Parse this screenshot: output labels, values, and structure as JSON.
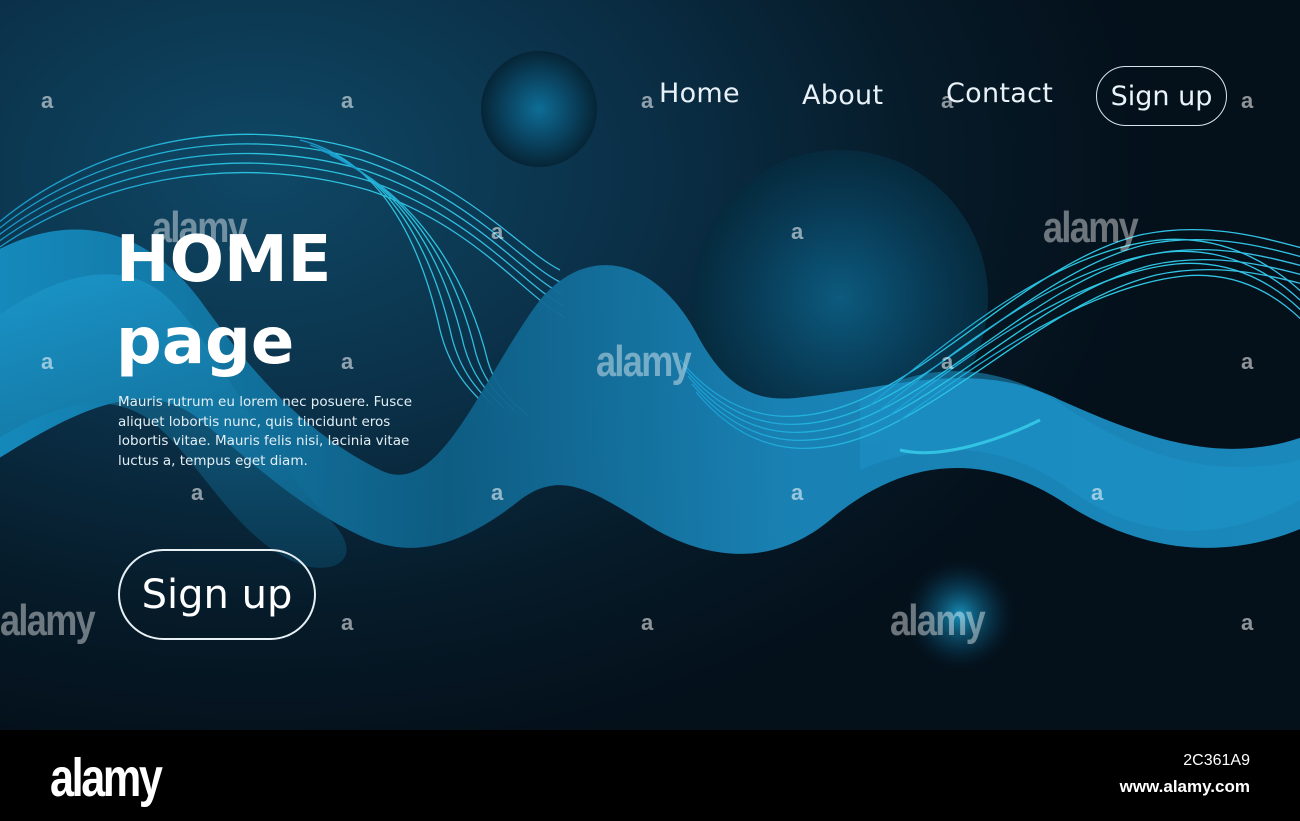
{
  "nav": {
    "links": [
      "Home",
      "About",
      "Contact"
    ],
    "cta_label": "Sign up"
  },
  "hero": {
    "title_line1": "HOME",
    "title_line2": "page",
    "body": "Mauris rutrum eu lorem nec posuere. Fusce aliquet lobortis nunc, quis tincidunt eros lobortis vitae. Mauris felis nisi, lacinia vitae luctus a, tempus eget diam.",
    "cta_label": "Sign up"
  },
  "watermark": {
    "brand": "alamy",
    "mark": "a"
  },
  "footer": {
    "logo": "alamy",
    "image_id": "2C361A9",
    "url": "www.alamy.com"
  },
  "colors": {
    "background": "#061a28",
    "wave_fill": "#1a7fae",
    "line_wave": "#2ec3e8",
    "text": "#ffffff"
  }
}
